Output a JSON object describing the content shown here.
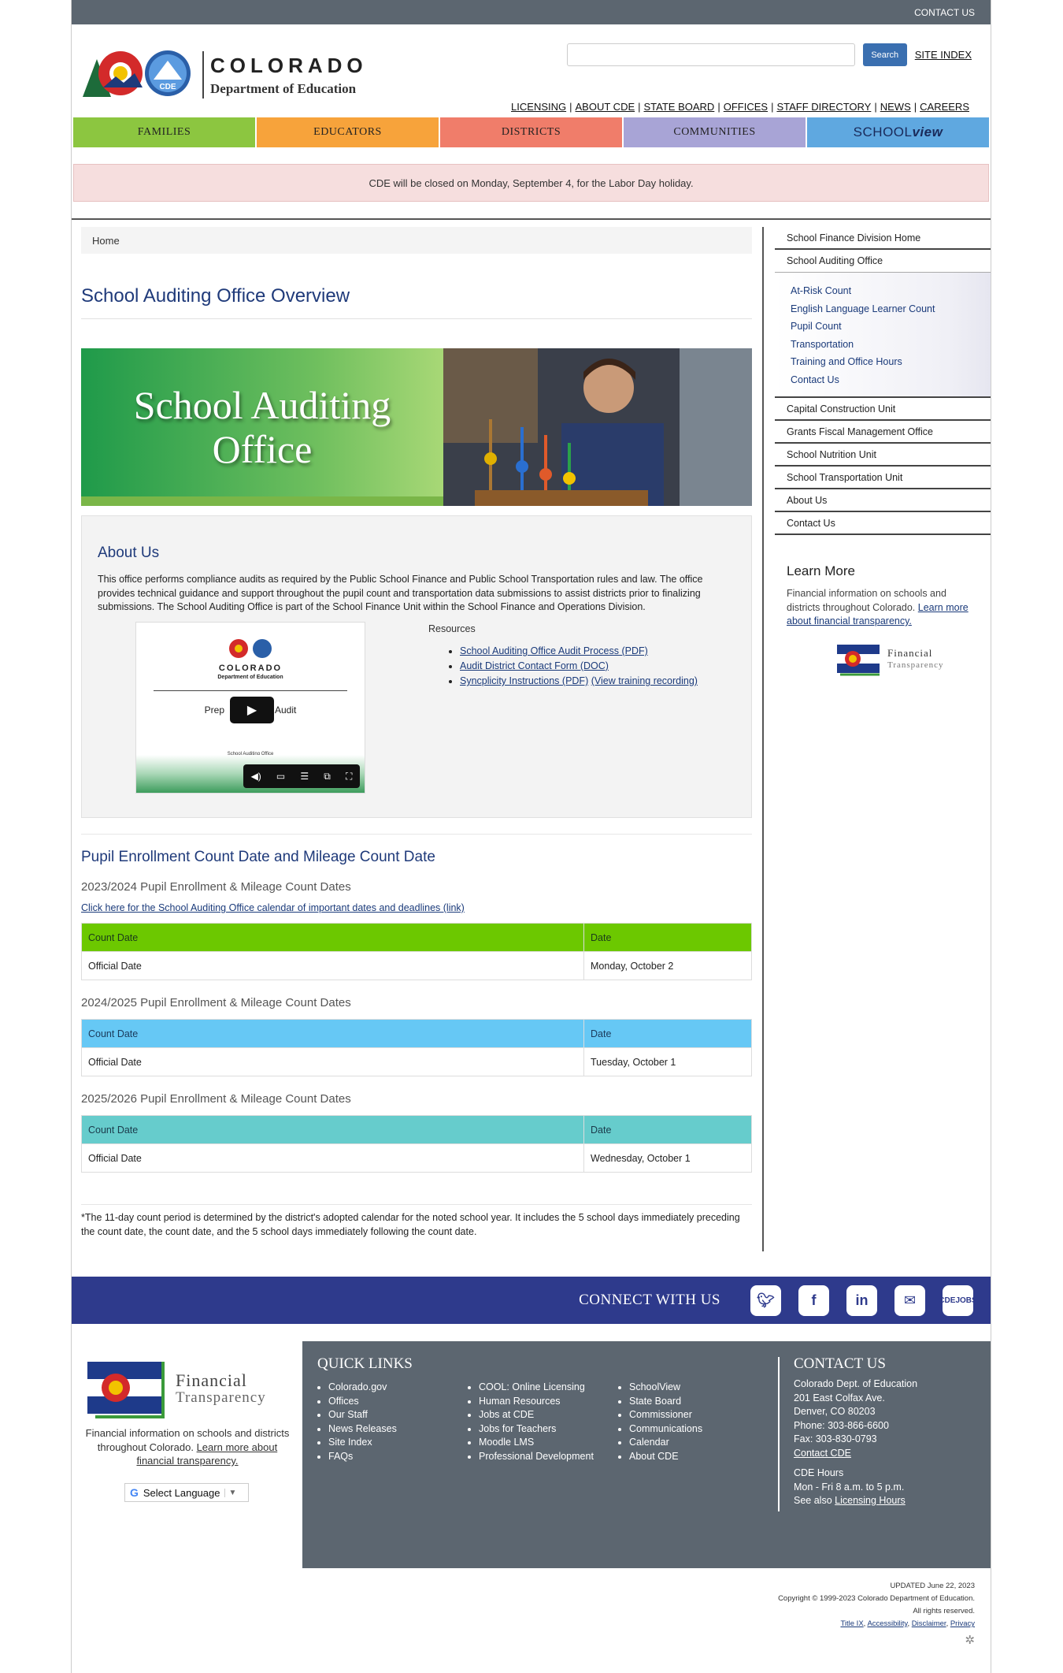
{
  "topbar": {
    "contact_label": "CONTACT US"
  },
  "header": {
    "logo_state": "COLORADO",
    "logo_dept": "Department of Education",
    "search_button": "Search",
    "site_index": "SITE INDEX",
    "util_links": [
      "LICENSING",
      "ABOUT CDE",
      "STATE BOARD",
      "OFFICES",
      "STAFF DIRECTORY",
      "NEWS",
      "CAREERS"
    ]
  },
  "nav": {
    "families": "FAMILIES",
    "educators": "EDUCATORS",
    "districts": "DISTRICTS",
    "communities": "COMMUNITIES",
    "schoolview_a": "SCHOOL",
    "schoolview_b": "view"
  },
  "alert": "CDE will be closed on Monday, September 4, for the Labor Day holiday.",
  "breadcrumb": "Home",
  "page_title": "School Auditing Office Overview",
  "hero": {
    "line1": "School Auditing",
    "line2": "Office"
  },
  "about": {
    "title": "About Us",
    "text": "This office performs compliance audits as required by the Public School Finance and Public School Transportation rules and law. The office provides technical guidance and support throughout the pupil count and transportation data submissions to assist districts prior to finalizing submissions. The School Auditing Office is part of the School Finance Unit within the School Finance and Operations Division.",
    "video": {
      "state": "COLORADO",
      "dept": "Department of Education",
      "caption_left": "Prep",
      "caption_right": "Audit",
      "small": "School Auditing Office"
    },
    "resources_title": "Resources",
    "resources": [
      "School Auditing Office Audit Process (PDF)",
      "Audit District Contact Form (DOC)",
      "Syncplicity Instructions (PDF)"
    ],
    "resources_extra": "(View training recording)"
  },
  "counts": {
    "title": "Pupil Enrollment Count Date and Mileage Count Date",
    "calendar_link": "Click here for the School Auditing Office calendar of important dates and deadlines (link)",
    "tables": [
      {
        "title": "2023/2024 Pupil Enrollment & Mileage Count Dates",
        "col1": "Count Date",
        "col2": "Date",
        "row_label": "Official Date",
        "row_value": "Monday, October 2"
      },
      {
        "title": "2024/2025 Pupil Enrollment & Mileage Count Dates",
        "col1": "Count Date",
        "col2": "Date",
        "row_label": "Official Date",
        "row_value": "Tuesday, October 1"
      },
      {
        "title": "2025/2026 Pupil Enrollment & Mileage Count Dates",
        "col1": "Count Date",
        "col2": "Date",
        "row_label": "Official Date",
        "row_value": "Wednesday, October 1"
      }
    ],
    "footnote": "*The 11-day count period is determined by the district's adopted calendar for the noted school year. It includes the 5 school days immediately preceding the count date, the count date, and the 5 school days immediately following the count date."
  },
  "sidebar": {
    "top": [
      "School Finance Division Home",
      "School Auditing Office"
    ],
    "sub": [
      "At-Risk Count",
      "English Language Learner Count",
      "Pupil Count",
      "Transportation",
      "Training and Office Hours",
      "Contact Us"
    ],
    "bottom": [
      "Capital Construction Unit",
      "Grants Fiscal Management Office",
      "School Nutrition Unit",
      "School Transportation Unit",
      "About Us",
      "Contact Us"
    ],
    "learn_more_title": "Learn More",
    "learn_more_text": "Financial information on schools and districts throughout Colorado.",
    "learn_more_link": "Learn more about financial transparency.",
    "ft_line1": "Financial",
    "ft_line2": "Transparency"
  },
  "connect": {
    "title": "CONNECT WITH US",
    "icons": [
      "twitter-icon",
      "facebook-icon",
      "linkedin-icon",
      "email-icon",
      "cde-jobs-icon"
    ],
    "jobs_line1": "CDE",
    "jobs_line2": "JOBS"
  },
  "footer": {
    "ft_line1": "Financial",
    "ft_line2": "Transparency",
    "ft_text": "Financial information on schools and districts throughout Colorado.",
    "ft_link": "Learn more about financial transparency.",
    "language": "Select Language",
    "quick_links_title": "QUICK LINKS",
    "col1": [
      "Colorado.gov",
      "Offices",
      "Our Staff",
      "News Releases",
      "Site Index",
      "FAQs"
    ],
    "col2": [
      "COOL: Online Licensing",
      "Human Resources",
      "Jobs at CDE",
      "Jobs for Teachers",
      "Moodle LMS",
      "Professional Development"
    ],
    "col3": [
      "SchoolView",
      "State Board",
      "Commissioner",
      "Communications",
      "Calendar",
      "About CDE"
    ],
    "contact_title": "CONTACT US",
    "contact_lines": [
      "Colorado Dept. of Education",
      "201 East Colfax Ave.",
      "Denver, CO 80203",
      "Phone: 303-866-6600",
      "Fax: 303-830-0793"
    ],
    "contact_link": "Contact CDE",
    "hours_title": "CDE Hours",
    "hours": "Mon - Fri 8 a.m. to 5 p.m.",
    "see_also": "See also",
    "licensing_hours": "Licensing Hours"
  },
  "bottom": {
    "updated": "UPDATED June 22, 2023",
    "copyright": "Copyright © 1999-2023 Colorado Department of Education.",
    "rights": "All rights reserved.",
    "links": [
      "Title IX",
      "Accessibility",
      "Disclaimer",
      "Privacy"
    ]
  }
}
